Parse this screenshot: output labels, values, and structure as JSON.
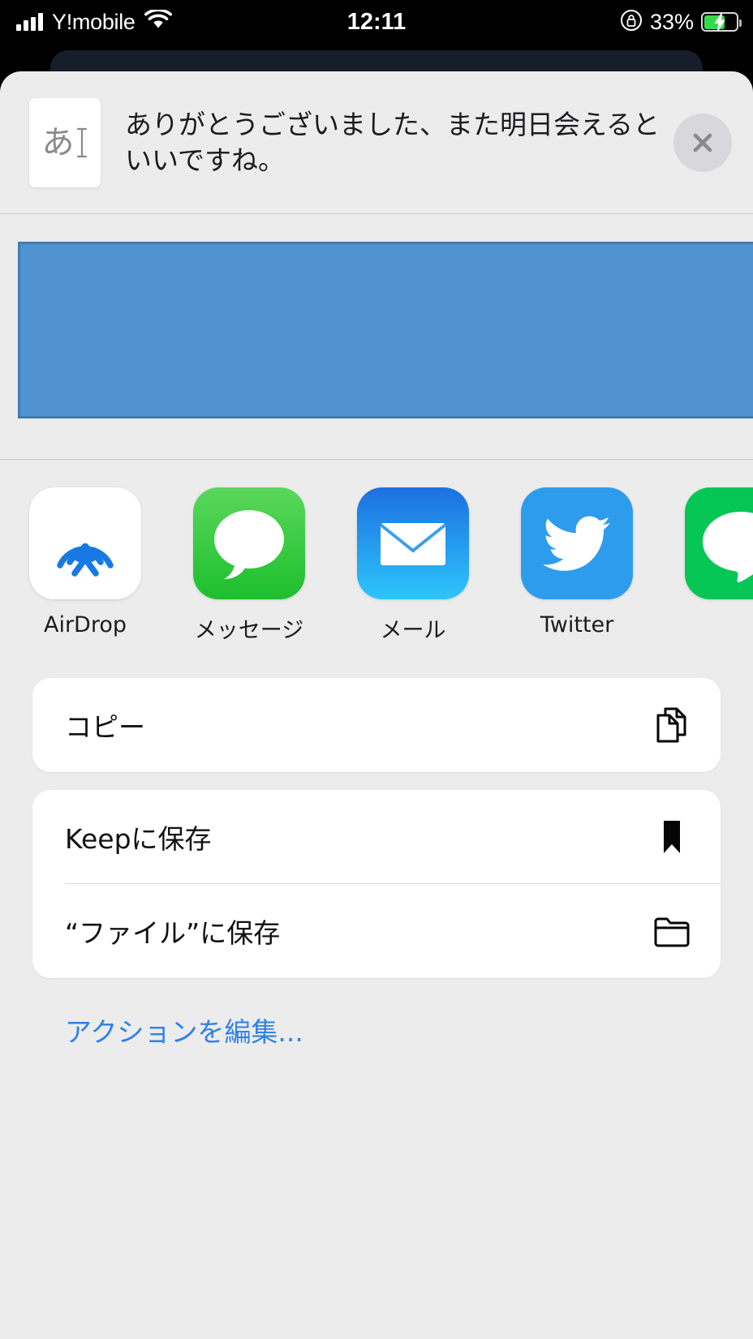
{
  "status_bar": {
    "carrier": "Y!mobile",
    "time": "12:11",
    "battery_percent": "33%",
    "battery_level": 33,
    "charging": true,
    "signal_icon": "cellular-bars-icon",
    "wifi_icon": "wifi-icon",
    "orientation_lock_icon": "rotation-lock-icon",
    "battery_icon": "battery-charging-icon"
  },
  "share_sheet": {
    "document_icon": "japanese-text-document-icon",
    "document_glyph": "あ",
    "shared_text": "ありがとうございました、また明日会えるといいですね。",
    "close_icon": "close-icon",
    "preview": {
      "name": "text-preview-box",
      "fill_color": "#5193d1",
      "border_color": "#3f7cb5"
    },
    "apps": [
      {
        "label": "AirDrop",
        "icon": "airdrop-icon",
        "tile_class": "tile-airdrop"
      },
      {
        "label": "メッセージ",
        "icon": "messages-icon",
        "tile_class": "tile-messages"
      },
      {
        "label": "メール",
        "icon": "mail-icon",
        "tile_class": "tile-mail"
      },
      {
        "label": "Twitter",
        "icon": "twitter-icon",
        "tile_class": "tile-twitter"
      },
      {
        "label": "",
        "icon": "line-icon",
        "tile_class": "tile-line"
      }
    ],
    "actions_group_1": [
      {
        "label": "コピー",
        "icon": "copy-documents-icon"
      }
    ],
    "actions_group_2": [
      {
        "label": "Keepに保存",
        "icon": "bookmark-icon"
      },
      {
        "label": "“ファイル”に保存",
        "icon": "folder-icon"
      }
    ],
    "edit_actions_label": "アクションを編集...",
    "accent_color": "#2f80e8"
  }
}
